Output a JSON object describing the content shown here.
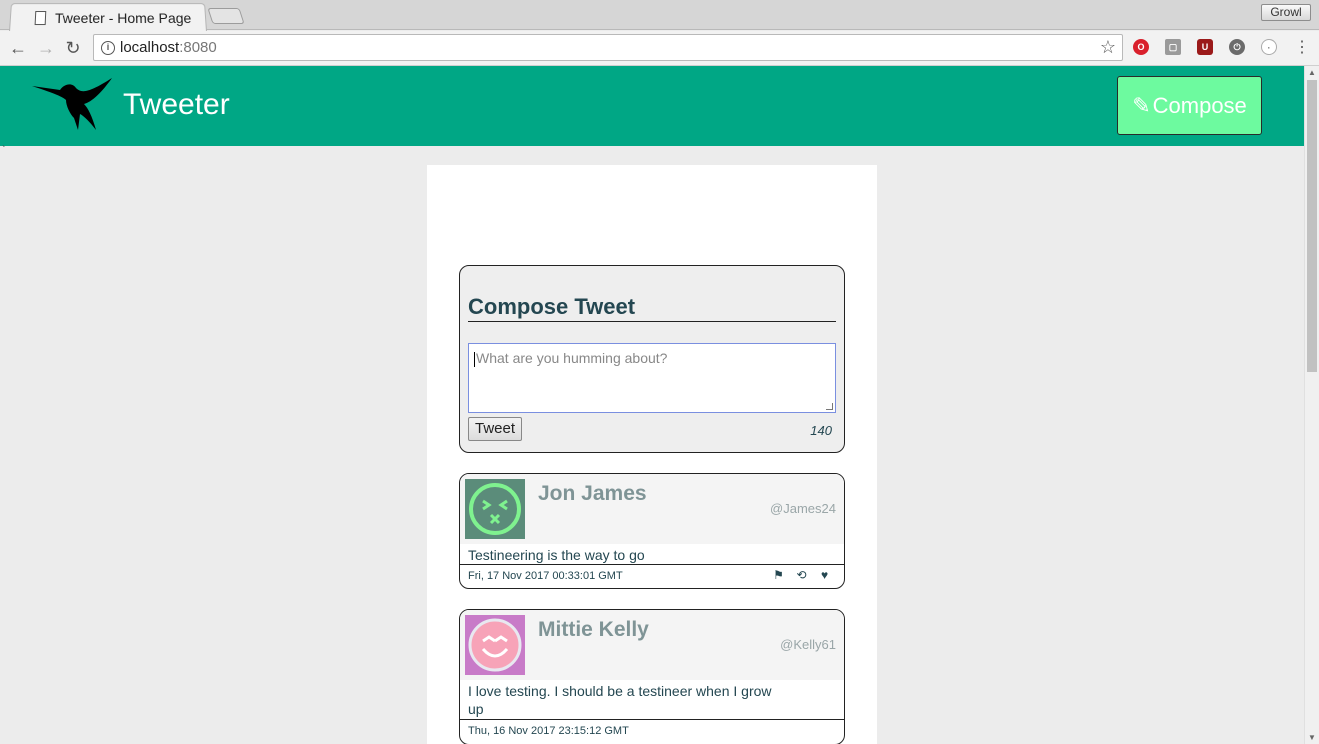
{
  "browser": {
    "tab_title": "Tweeter - Home Page",
    "url_host": "localhost",
    "url_port": ":8080",
    "growl_label": "Growl"
  },
  "header": {
    "brand": "Tweeter",
    "compose_label": "Compose"
  },
  "compose": {
    "title": "Compose Tweet",
    "placeholder": "What are you humming about?",
    "submit_label": "Tweet",
    "counter": "140"
  },
  "tweets": [
    {
      "name": "Jon James",
      "handle": "@James24",
      "content": "Testineering is the way to go",
      "date": "Fri, 17 Nov 2017 00:33:01 GMT",
      "avatar_bg": "#5b8c7a",
      "avatar_face": "#7ff28f"
    },
    {
      "name": "Mittie Kelly",
      "handle": "@Kelly61",
      "content": "I love testing. I should be a testineer when I grow up",
      "date": "Thu, 16 Nov 2017 23:15:12 GMT",
      "avatar_bg": "#c87bc8",
      "avatar_face": "#f7a3b8"
    }
  ],
  "colors": {
    "header_bg": "#00a785",
    "compose_btn_bg": "#6dfa9f",
    "text_dark": "#244751"
  }
}
